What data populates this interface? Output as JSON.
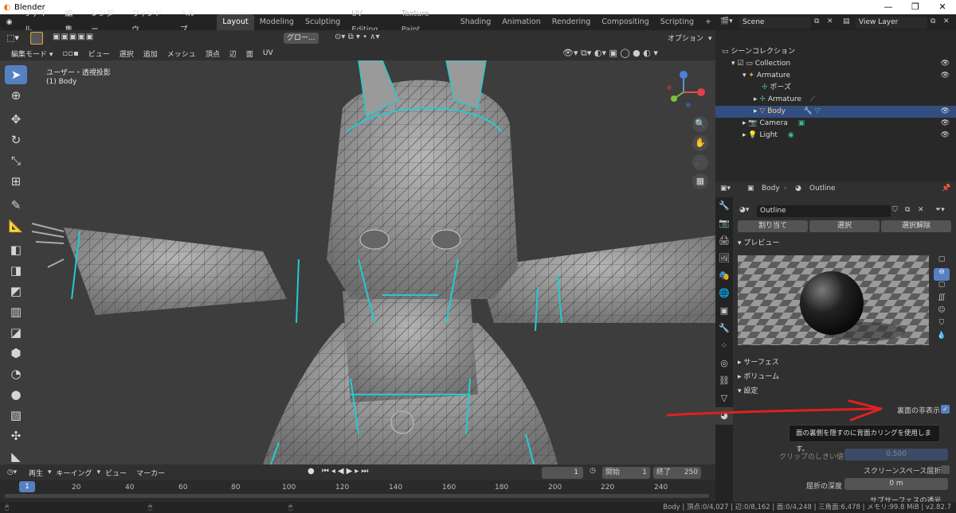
{
  "window": {
    "title": "Blender",
    "minimize": "—",
    "maximize": "❐",
    "close": "✕"
  },
  "menu": [
    "ファイル",
    "編集",
    "レンダー",
    "ウィンドウ",
    "ヘルプ"
  ],
  "workspaces": [
    "Layout",
    "Modeling",
    "Sculpting",
    "UV Editing",
    "Texture Paint",
    "Shading",
    "Animation",
    "Rendering",
    "Compositing",
    "Scripting"
  ],
  "add_workspace": "+",
  "scene": {
    "name": "Scene",
    "view_layer": "View Layer"
  },
  "viewport": {
    "transform_orientation": "グロー...",
    "options": "オプション",
    "mode": "編集モード",
    "header_menus": [
      "ビュー",
      "選択",
      "追加",
      "メッシュ",
      "頂点",
      "辺",
      "面",
      "UV"
    ],
    "view_name": "ユーザー・透視投影",
    "object_label": "(1) Body",
    "axes": [
      "X",
      "Y",
      "Z"
    ]
  },
  "outliner": {
    "search_placeholder": "",
    "rows": [
      {
        "label": "シーンコレクション",
        "indent": 0
      },
      {
        "label": "Collection",
        "indent": 1
      },
      {
        "label": "Armature",
        "indent": 2
      },
      {
        "label": "ポーズ",
        "indent": 3
      },
      {
        "label": "Armature",
        "indent": 3
      },
      {
        "label": "Body",
        "indent": 3,
        "selected": true
      },
      {
        "label": "Camera",
        "indent": 2
      },
      {
        "label": "Light",
        "indent": 2
      }
    ]
  },
  "properties": {
    "breadcrumb_object": "Body",
    "breadcrumb_material": "Outline",
    "material_name": "Outline",
    "buttons": [
      "割り当て",
      "選択",
      "選択解除"
    ],
    "panels": {
      "preview": "プレビュー",
      "surface": "サーフェス",
      "volume": "ボリューム",
      "settings": "設定"
    },
    "backface_label": "裏面の非表示",
    "tooltip": "面の裏側を隠すのに背面カリングを使用します。",
    "clip_label": "クリップのしきい値",
    "clip_value": "0.500",
    "ssr_label": "スクリーンスペース屈折",
    "refraction_depth_label": "屈折の深度",
    "refraction_depth_value": "0 m",
    "subsurface_label": "サブサーフェスの透光"
  },
  "timeline": {
    "menus": [
      "再生",
      "キーイング",
      "ビュー",
      "マーカー"
    ],
    "current_frame": "1",
    "start_label": "開始",
    "start": "1",
    "end_label": "終了",
    "end": "250",
    "ticks": [
      "1",
      "20",
      "40",
      "60",
      "80",
      "100",
      "120",
      "140",
      "160",
      "180",
      "200",
      "220",
      "240"
    ]
  },
  "status": "Body | 頂点:0/4,027 | 辺:0/8,162 | 面:0/4,248 | 三角面:6,478 | メモリ:99.8 MiB | v2.82.7",
  "colors": {
    "accent": "#5680c2",
    "selected_row": "#334d80",
    "outline_mesh": "#27c9d0",
    "annotation_red": "#e02020"
  }
}
